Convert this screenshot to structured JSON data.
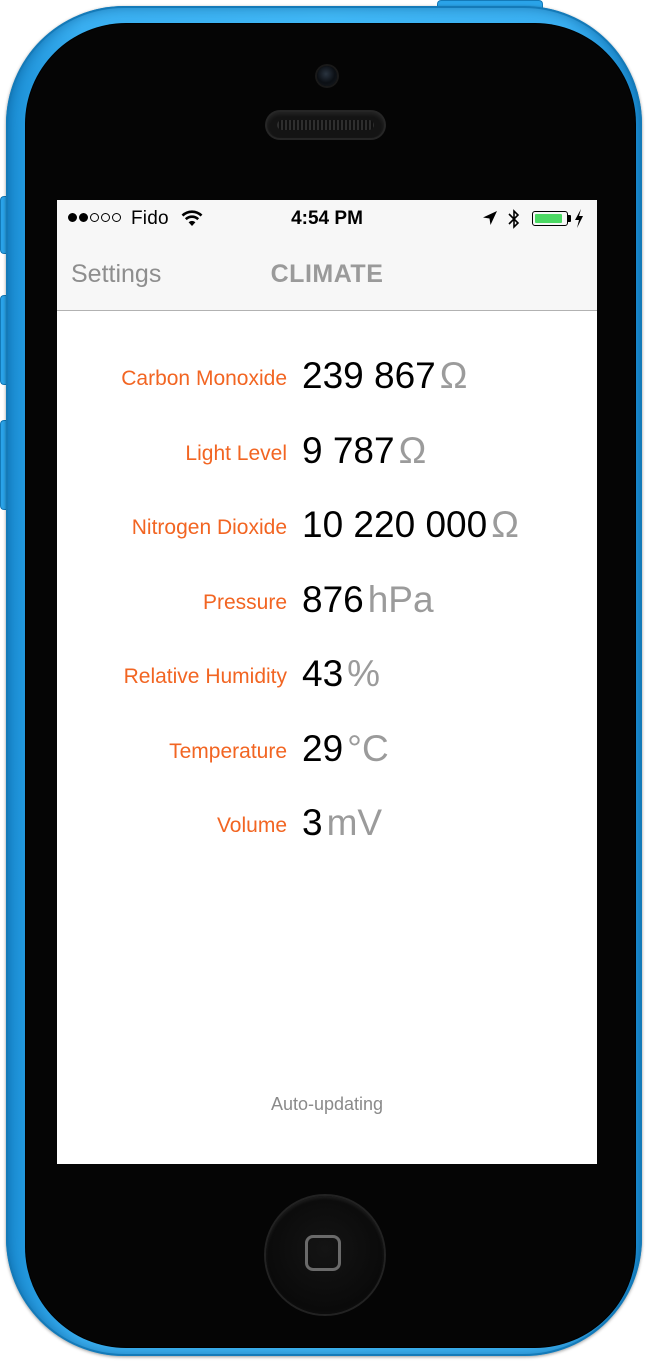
{
  "status_bar": {
    "carrier": "Fido",
    "time": "4:54 PM",
    "signal_bars_filled": 2,
    "signal_bars_total": 5,
    "battery_level": 0.9,
    "battery_color": "#4cd964"
  },
  "nav": {
    "back_label": "Settings",
    "title": "CLIMATE"
  },
  "colors": {
    "accent": "#f26522",
    "unit_gray": "#9b9b9b"
  },
  "readings": [
    {
      "label": "Carbon Monoxide",
      "value": "239 867",
      "unit": "Ω"
    },
    {
      "label": "Light Level",
      "value": "9 787",
      "unit": "Ω"
    },
    {
      "label": "Nitrogen Dioxide",
      "value": "10 220 000",
      "unit": "Ω"
    },
    {
      "label": "Pressure",
      "value": "876",
      "unit": "hPa"
    },
    {
      "label": "Relative Humidity",
      "value": "43",
      "unit": "%"
    },
    {
      "label": "Temperature",
      "value": "29",
      "unit": "°C"
    },
    {
      "label": "Volume",
      "value": "3",
      "unit": "mV"
    }
  ],
  "footer": {
    "status_text": "Auto-updating"
  }
}
